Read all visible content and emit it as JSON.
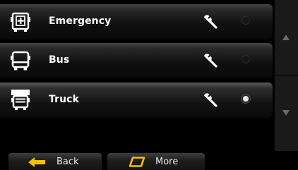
{
  "vehicles": [
    {
      "label": "Emergency",
      "icon": "emergency-vehicle-icon",
      "selected": false
    },
    {
      "label": "Bus",
      "icon": "bus-icon",
      "selected": false
    },
    {
      "label": "Truck",
      "icon": "truck-icon",
      "selected": true
    }
  ],
  "footer": {
    "back_label": "Back",
    "more_label": "More"
  },
  "colors": {
    "accent_yellow": "#f2c200",
    "text": "#ffffff",
    "scrollbar": "#1a1a1a"
  }
}
